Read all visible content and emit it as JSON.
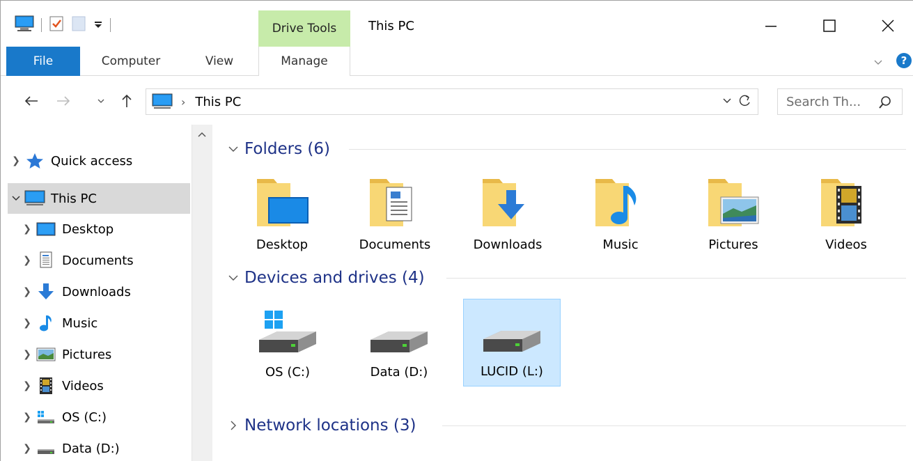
{
  "window": {
    "title": "This PC"
  },
  "contextual_tab": {
    "label": "Drive Tools"
  },
  "ribbon": {
    "tabs": [
      {
        "label": "File"
      },
      {
        "label": "Computer"
      },
      {
        "label": "View"
      },
      {
        "label": "Manage"
      }
    ]
  },
  "address": {
    "crumb": "This PC"
  },
  "search": {
    "placeholder": "Search Th..."
  },
  "nav": {
    "items": [
      {
        "label": "Quick access"
      },
      {
        "label": "This PC"
      },
      {
        "label": "Desktop"
      },
      {
        "label": "Documents"
      },
      {
        "label": "Downloads"
      },
      {
        "label": "Music"
      },
      {
        "label": "Pictures"
      },
      {
        "label": "Videos"
      },
      {
        "label": "OS (C:)"
      },
      {
        "label": "Data (D:)"
      }
    ]
  },
  "groups": {
    "folders": {
      "header": "Folders (6)",
      "items": [
        {
          "label": "Desktop",
          "icon": "desktop-folder-icon"
        },
        {
          "label": "Documents",
          "icon": "documents-folder-icon"
        },
        {
          "label": "Downloads",
          "icon": "downloads-folder-icon"
        },
        {
          "label": "Music",
          "icon": "music-folder-icon"
        },
        {
          "label": "Pictures",
          "icon": "pictures-folder-icon"
        },
        {
          "label": "Videos",
          "icon": "videos-folder-icon"
        }
      ]
    },
    "devices": {
      "header": "Devices and drives (4)",
      "items": [
        {
          "label": "OS (C:)"
        },
        {
          "label": "Data (D:)"
        },
        {
          "label": "LUCID (L:)"
        }
      ]
    },
    "network": {
      "header": "Network locations (3)"
    }
  },
  "colors": {
    "accent": "#1979ca",
    "header_text": "#1e3287",
    "drive_tools": "#c7ebaa",
    "selected_tile": "#cce8ff",
    "folder": "#f8d775"
  }
}
